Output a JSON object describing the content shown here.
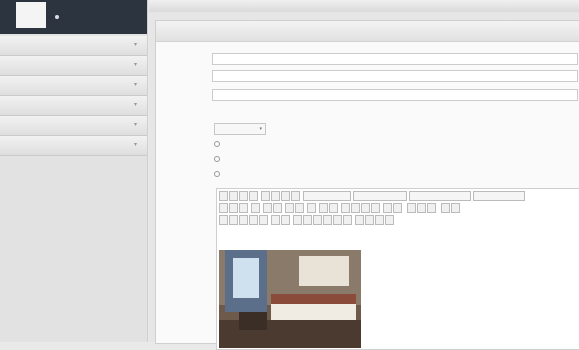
{
  "brand": {
    "user": ""
  },
  "sidebar": {
    "items": [
      {
        "label": ""
      },
      {
        "label": ""
      },
      {
        "label": ""
      },
      {
        "label": ""
      },
      {
        "label": ""
      },
      {
        "label": ""
      }
    ]
  },
  "panel": {
    "title": ""
  },
  "form": {
    "title": {
      "label": "",
      "value": ""
    },
    "slug": {
      "label": "",
      "value": ""
    },
    "video": {
      "label": "",
      "value": "",
      "hint": "",
      "hint_url": ""
    },
    "category": {
      "label": "",
      "value": ""
    },
    "headline": {
      "label": "",
      "option": ""
    },
    "pilihan": {
      "label": "",
      "option": ""
    },
    "utama": {
      "label": "",
      "option": ""
    },
    "content": {
      "label": ""
    }
  },
  "editor": {
    "font_label": "",
    "size_label": "",
    "format_label": "",
    "style_label": ""
  },
  "caption": "",
  "icons": {
    "chevron": "chevron-down-icon",
    "user": "user-icon"
  }
}
